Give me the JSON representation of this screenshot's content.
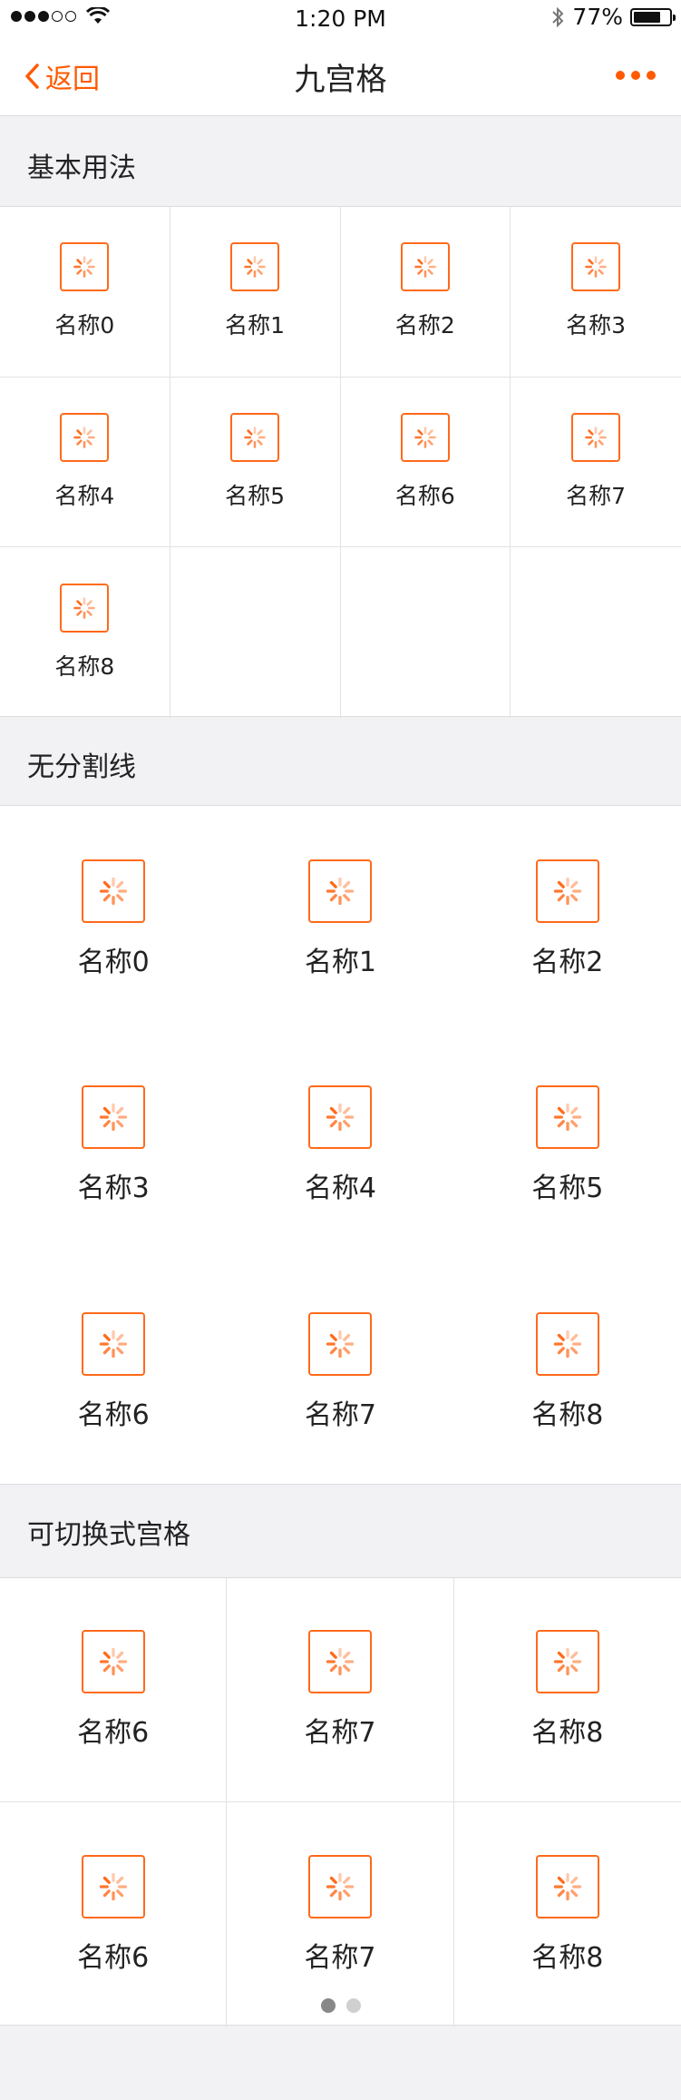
{
  "status_bar": {
    "time": "1:20 PM",
    "battery": "77%",
    "battery_level": 0.77
  },
  "nav": {
    "back_label": "返回",
    "title": "九宫格"
  },
  "sections": [
    {
      "title": "基本用法",
      "items": [
        "名称0",
        "名称1",
        "名称2",
        "名称3",
        "名称4",
        "名称5",
        "名称6",
        "名称7",
        "名称8"
      ]
    },
    {
      "title": "无分割线",
      "items": [
        "名称0",
        "名称1",
        "名称2",
        "名称3",
        "名称4",
        "名称5",
        "名称6",
        "名称7",
        "名称8"
      ]
    },
    {
      "title": "可切换式宫格",
      "items": [
        "名称6",
        "名称7",
        "名称8",
        "名称6",
        "名称7",
        "名称8"
      ],
      "pager": {
        "pages": 2,
        "current": 1
      }
    }
  ],
  "colors": {
    "accent": "#ff5a00",
    "icon": "#ff6a1a",
    "background": "#f2f2f5"
  },
  "icon_name": "loading-spinner-icon"
}
